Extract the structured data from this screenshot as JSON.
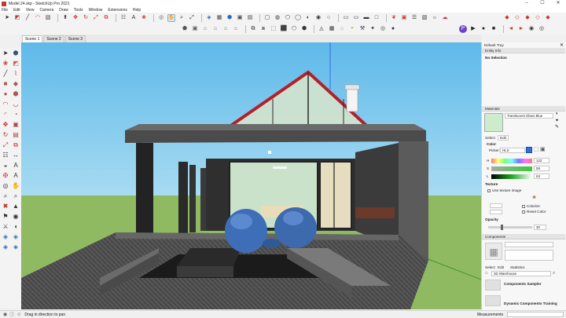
{
  "window": {
    "title": "Model 24.skp - SketchUp Pro 2021",
    "controls": [
      "–",
      "☐",
      "✕"
    ]
  },
  "menu": [
    "File",
    "Edit",
    "View",
    "Camera",
    "Draw",
    "Tools",
    "Window",
    "Extensions",
    "Help"
  ],
  "scenes": [
    "Scene 1",
    "Scene 2",
    "Scene 3"
  ],
  "tray": {
    "title": "Default Tray",
    "entity_info": {
      "header": "Entity Info",
      "selection": "No Selection"
    },
    "materials": {
      "header": "Materials",
      "name": "Translucent Glass Blue",
      "tabs": [
        "Select",
        "Edit"
      ],
      "color_label": "Color",
      "picker_label": "Picker:",
      "picker_value": "HLS",
      "h_label": "H",
      "h_value": "122",
      "s_label": "S",
      "s_value": "59",
      "l_label": "L",
      "l_value": "63",
      "texture_label": "Texture",
      "use_texture": "Use texture image",
      "colorize": "Colorize",
      "reset_color": "Reset Color",
      "opacity_label": "Opacity",
      "opacity_value": "30",
      "swatch_color": "#cdeccd"
    },
    "components": {
      "header": "Components",
      "tabs": [
        "Select",
        "Edit",
        "Statistics"
      ],
      "search": "3D Warehouse",
      "items": [
        "Components Sampler",
        "Dynamic Components Training"
      ]
    }
  },
  "status": {
    "text": "Drag in direction to pan",
    "measurements_label": "Measurements"
  },
  "colors": {
    "roof_trim": "#b3202a",
    "sky": "#6ec3ea",
    "ground": "#8fba61",
    "deck": "#4a4a4a",
    "accent": "#2f6fd1"
  }
}
